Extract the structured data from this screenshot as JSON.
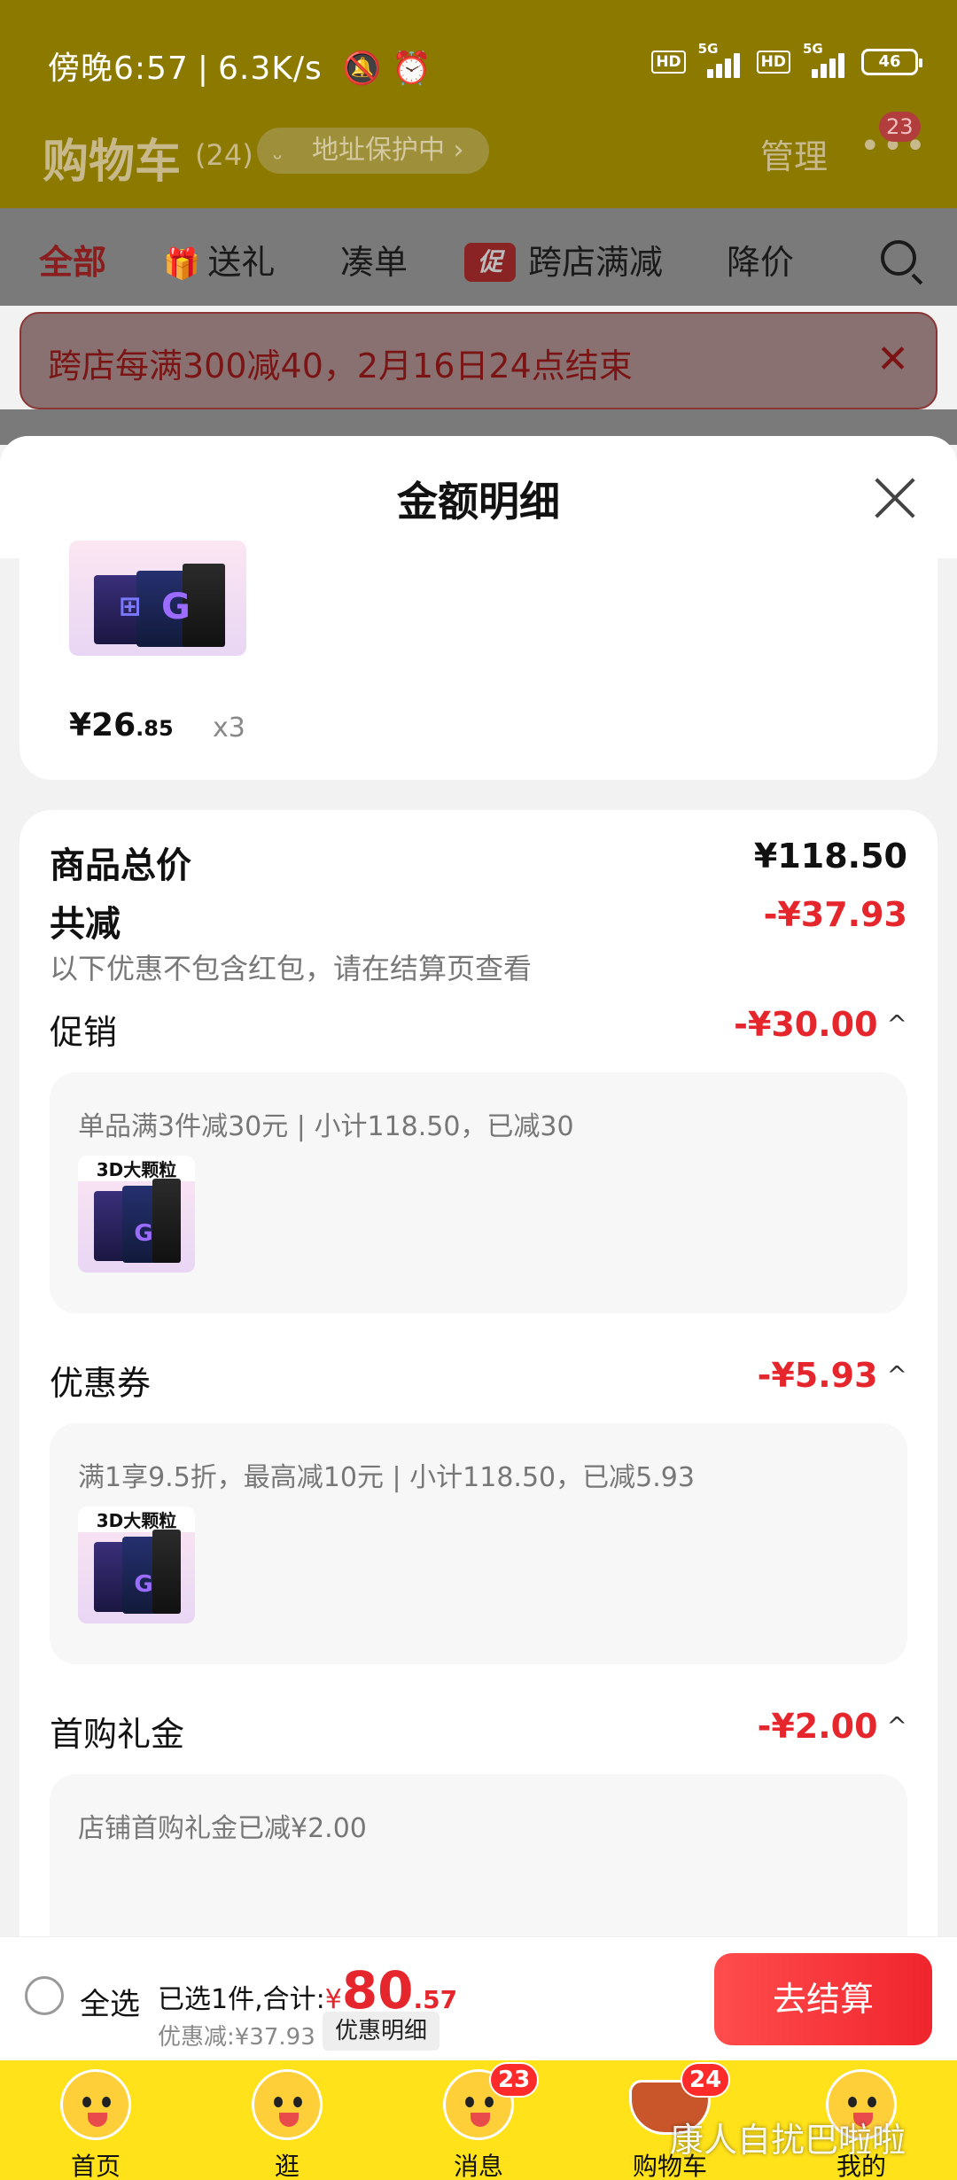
{
  "status_bar": {
    "time": "傍晚6:57",
    "speed": "6.3K/s",
    "hd1": "HD",
    "net1": "5G",
    "hd2": "HD",
    "net2": "5G",
    "battery": "46"
  },
  "header": {
    "title": "购物车",
    "count": "(24)",
    "address_pill": "地址保护中",
    "address_chevron": "›",
    "manage": "管理",
    "more_badge": "23"
  },
  "tabs": [
    {
      "label": "全部"
    },
    {
      "label": "送礼"
    },
    {
      "label": "凑单"
    },
    {
      "label": "跨店满减",
      "tag": "促"
    },
    {
      "label": "降价"
    }
  ],
  "notice": {
    "text": "跨店每满300减40，2月16日24点结束",
    "close": "✕"
  },
  "sheet": {
    "title": "金额明细",
    "product": {
      "price_int": "¥26",
      "price_dec": ".85",
      "qty": "x3",
      "thumb_label": "3D大颗粒"
    },
    "total_label": "商品总价",
    "total_value": "¥118.50",
    "reduce_label": "共减",
    "reduce_value": "-¥37.93",
    "reduce_note": "以下优惠不包含红包，请在结算页查看",
    "sections": [
      {
        "label": "促销",
        "value": "-¥30.00",
        "caret": "^",
        "desc": "单品满3件减30元 | 小计118.50，已减30",
        "thumb_label": "3D大颗粒"
      },
      {
        "label": "优惠券",
        "value": "-¥5.93",
        "caret": "^",
        "desc": "满1享9.5折，最高减10元 | 小计118.50，已减5.93",
        "thumb_label": "3D大颗粒"
      },
      {
        "label": "首购礼金",
        "value": "-¥2.00",
        "caret": "^",
        "desc": "店铺首购礼金已减¥2.00"
      }
    ]
  },
  "checkout": {
    "select_all": "全选",
    "summary_prefix": "已选1件,合计:",
    "yen": "¥",
    "total_int": "80",
    "total_dec": ".57",
    "discount_text": "优惠减:¥37.93",
    "discount_detail_btn": "优惠明细",
    "pay_button": "去结算"
  },
  "bottom_nav": [
    {
      "label": "首页"
    },
    {
      "label": "逛"
    },
    {
      "label": "消息",
      "badge": "23"
    },
    {
      "label": "购物车",
      "badge": "24"
    },
    {
      "label": "我的"
    }
  ],
  "watermark": "康人自扰巴啦啦",
  "colors": {
    "accent_red": "#e5262c",
    "nav_yellow": "#ffe21a",
    "header_dimmed": "#8c7a00"
  }
}
